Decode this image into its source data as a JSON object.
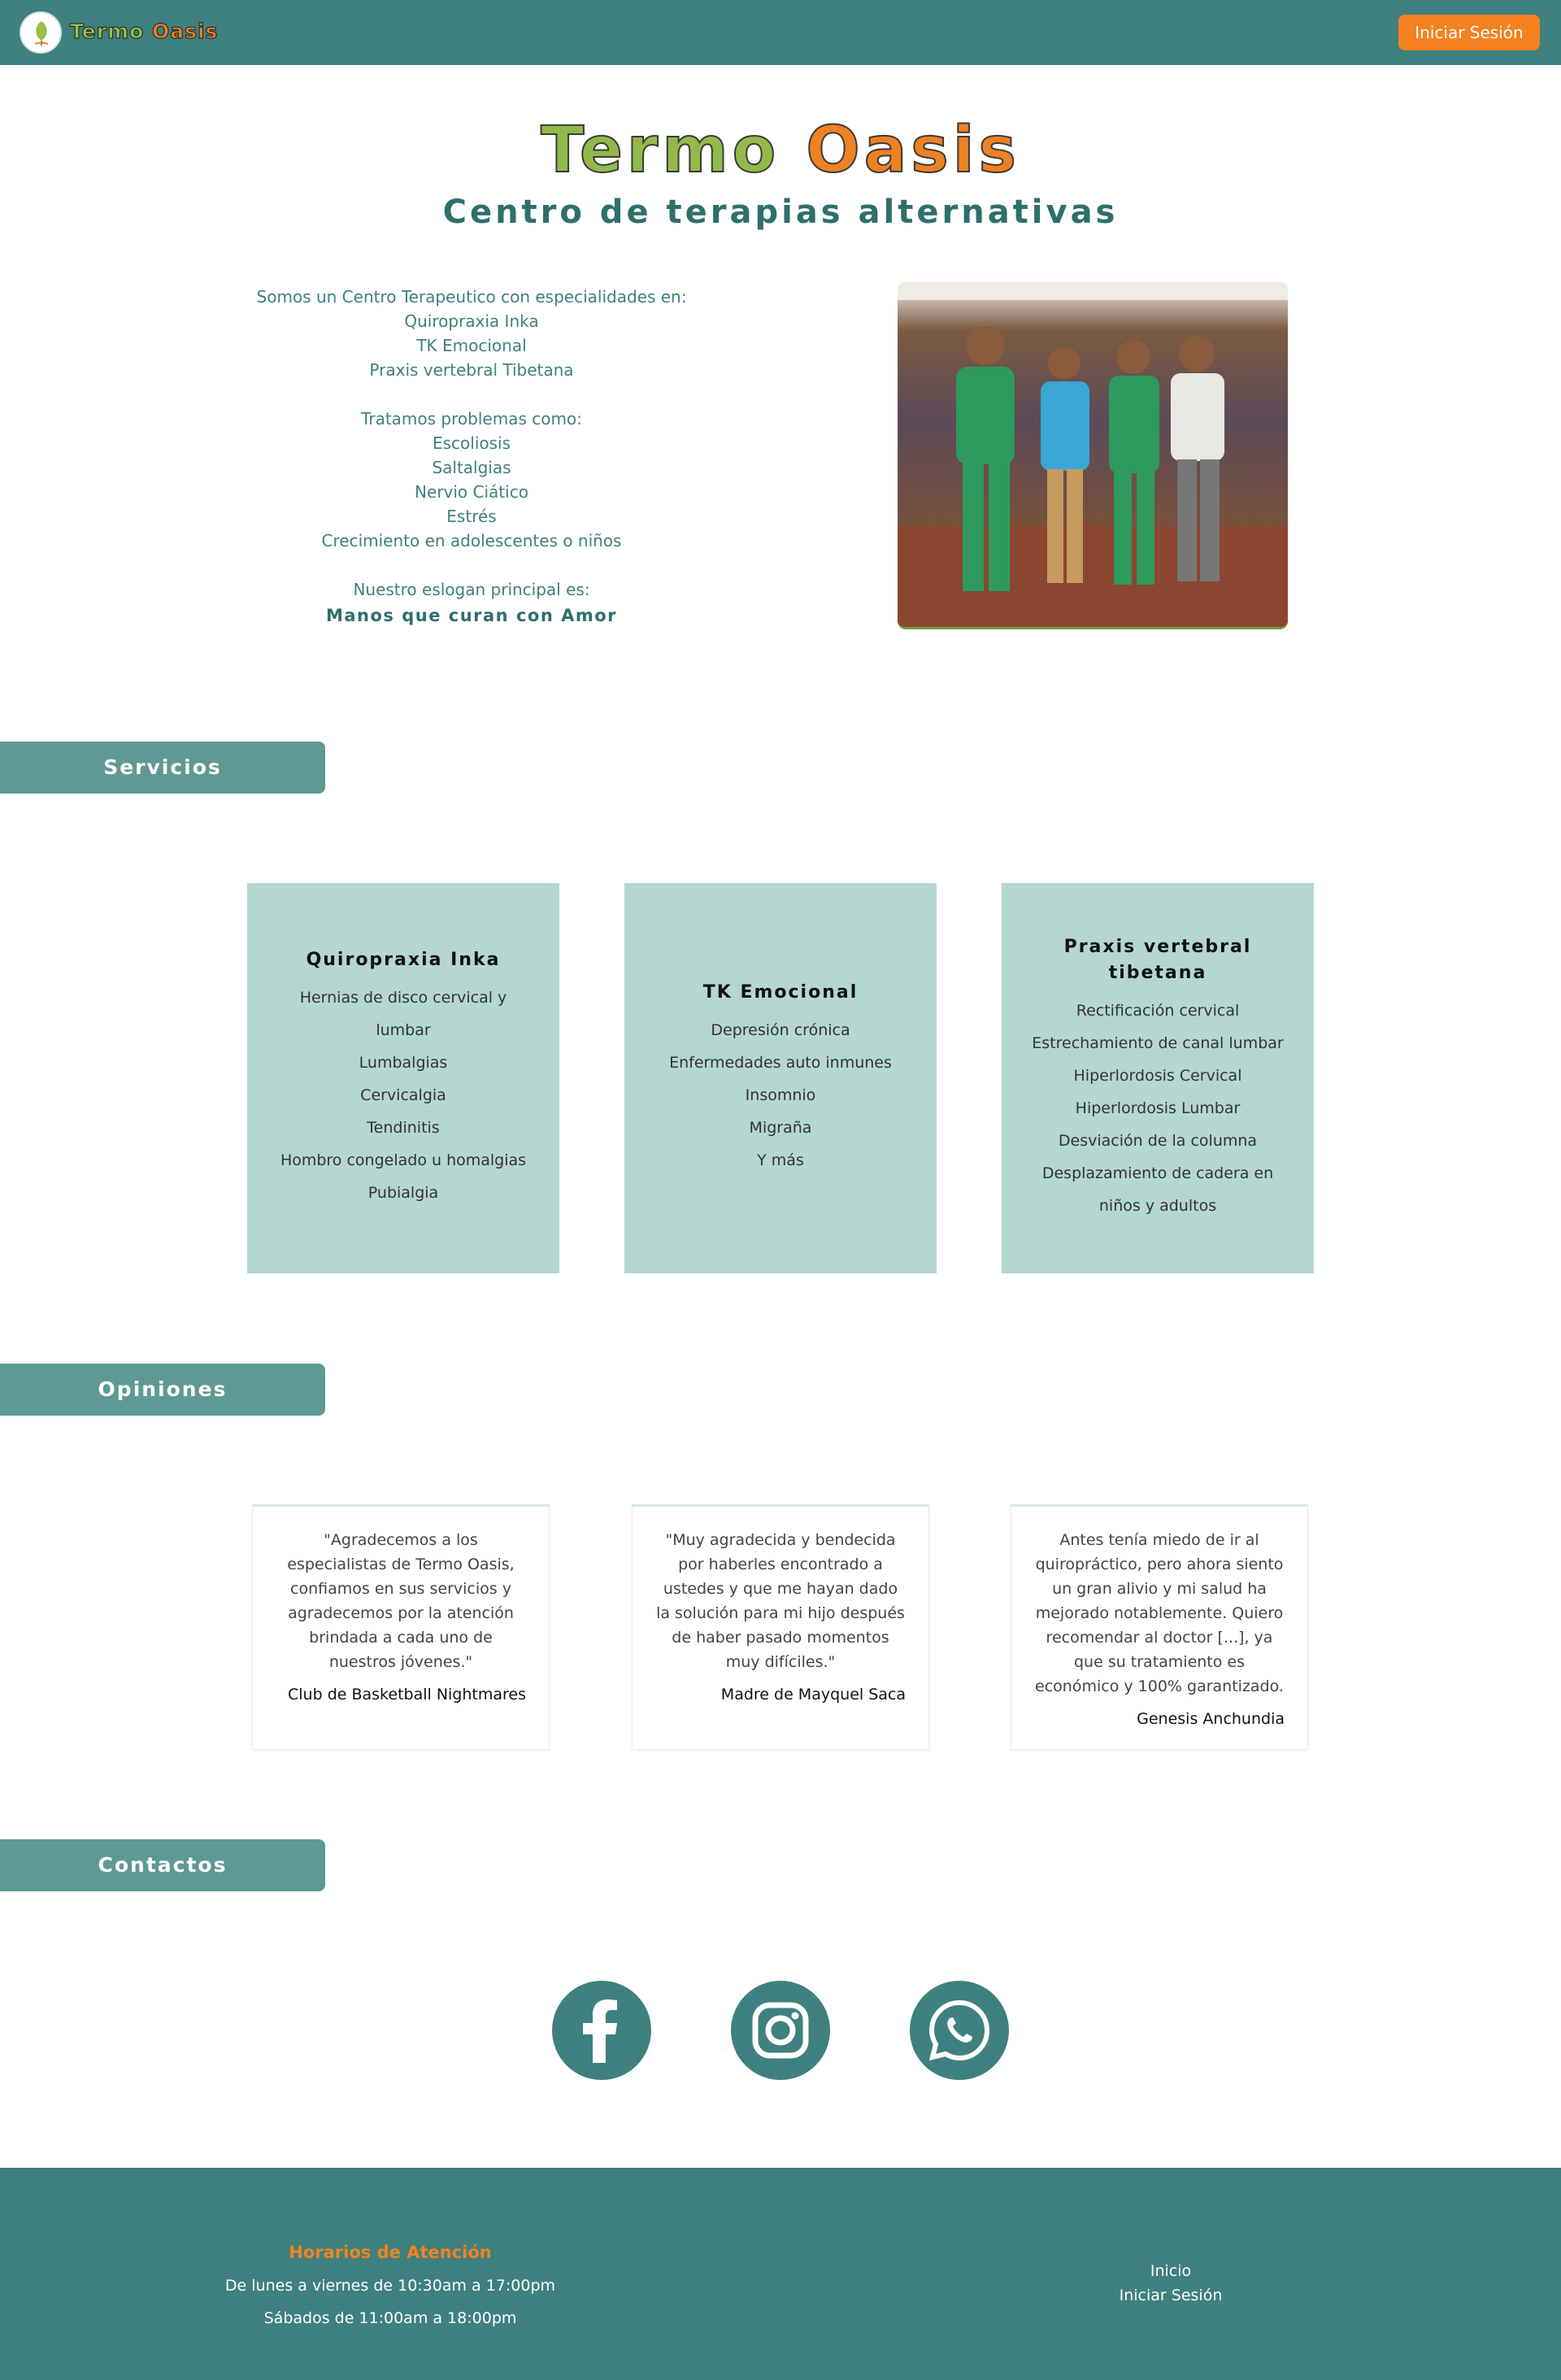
{
  "navbar": {
    "brand_part1": "Termo",
    "brand_part2": "Oasis",
    "logo_icon": "leaf-logo-icon",
    "login_label": "Iniciar Sesión"
  },
  "hero": {
    "title_part1": "Termo",
    "title_part2": "Oasis",
    "subtitle": "Centro de terapias alternativas"
  },
  "intro": {
    "lines": [
      "Somos un Centro Terapeutico con especialidades en:",
      "Quiropraxia Inka",
      "TK Emocional",
      "Praxis vertebral Tibetana"
    ],
    "problems_heading": "Tratamos problemas como:",
    "problems": [
      "Escoliosis",
      "Saltalgias",
      "Nervio Ciático",
      "Estrés",
      "Crecimiento en adolescentes o niños"
    ],
    "slogan_heading": "Nuestro eslogan principal es:",
    "slogan": "Manos que curan con Amor"
  },
  "sections": {
    "services": "Servicios",
    "opinions": "Opiniones",
    "contacts": "Contactos"
  },
  "services": [
    {
      "title": "Quiropraxia Inka",
      "items": [
        "Hernias de disco cervical y lumbar",
        "Lumbalgias",
        "Cervicalgia",
        "Tendinitis",
        "Hombro congelado u homalgias",
        "Pubialgia"
      ]
    },
    {
      "title": "TK Emocional",
      "items": [
        "Depresión crónica",
        "Enfermedades auto inmunes",
        "Insomnio",
        "Migraña",
        "Y más"
      ]
    },
    {
      "title": "Praxis vertebral tibetana",
      "items": [
        "Rectificación cervical",
        "Estrechamiento de canal lumbar",
        "Hiperlordosis Cervical",
        "Hiperlordosis Lumbar",
        "Desviación de la columna",
        "Desplazamiento de cadera en niños y adultos"
      ]
    }
  ],
  "opinions": [
    {
      "quote": "\"Agradecemos a los especialistas de Termo Oasis, confiamos en sus servicios y agradecemos por la atención brindada a cada uno de nuestros jóvenes.\"",
      "author": "Club de Basketball Nightmares"
    },
    {
      "quote": "\"Muy agradecida y bendecida por haberles encontrado a ustedes y que me hayan dado la solución para mi hijo después de haber pasado momentos muy difíciles.\"",
      "author": "Madre de Mayquel Saca"
    },
    {
      "quote": "Antes tenía miedo de ir al quiropráctico, pero ahora siento un gran alivio y mi salud ha mejorado notablemente. Quiero recomendar al doctor [...], ya que su tratamiento es económico y 100% garantizado.",
      "author": "Genesis Anchundia"
    }
  ],
  "social": [
    "facebook-icon",
    "instagram-icon",
    "whatsapp-icon"
  ],
  "footer": {
    "hours_title": "Horarios de Atención",
    "hours_weekdays": "De lunes a viernes de 10:30am a 17:00pm",
    "hours_saturday": "Sábados de 11:00am a 18:00pm",
    "link_home": "Inicio",
    "link_login": "Iniciar Sesión"
  },
  "colors": {
    "primary": "#3e817e",
    "accent": "#f3821f",
    "brand_green": "#93b94a",
    "card_bg": "#b5d7d1",
    "section_bar": "#5e9995"
  }
}
